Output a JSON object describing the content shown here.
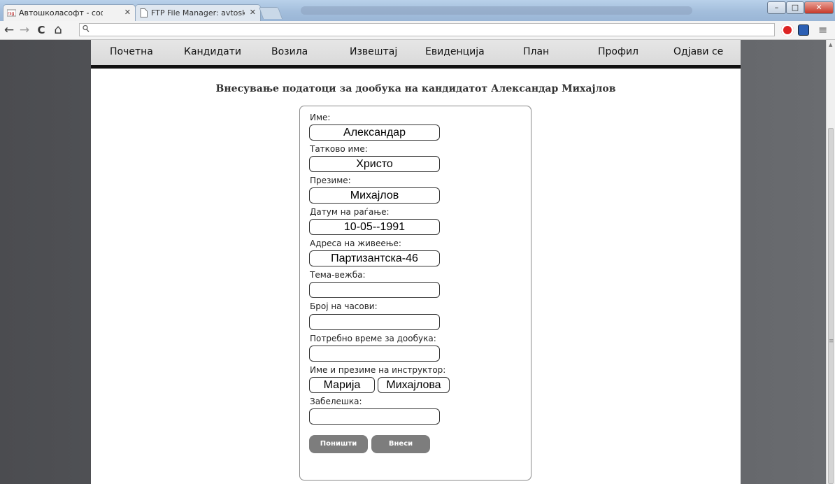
{
  "browser": {
    "tabs": [
      {
        "label": "Автошколасофт - софтв",
        "favicon": "site-favicon",
        "active": true
      },
      {
        "label": "FTP File Manager: avtosko",
        "favicon": "page-icon",
        "active": false
      }
    ],
    "window_controls": {
      "minimize": "–",
      "maximize": "□",
      "close": "✕"
    },
    "nav": {
      "back": "←",
      "forward": "→",
      "reload": "C",
      "home": "⌂"
    },
    "address": {
      "value": "",
      "icon": "search-icon"
    },
    "extensions": [
      "stop-extension-icon",
      "extension-icon"
    ],
    "menu_icon": "≡"
  },
  "nav": {
    "items": [
      "Почетна",
      "Кандидати",
      "Возила",
      "Извештај",
      "Евиденција",
      "План",
      "Профил",
      "Одјави се"
    ]
  },
  "page": {
    "heading": "Внесување податоци за дообука на кандидатот Александар Михајлов"
  },
  "form": {
    "fields": [
      {
        "label": "Име:",
        "value": "Александар"
      },
      {
        "label": "Татково име:",
        "value": "Христо"
      },
      {
        "label": "Презиме:",
        "value": "Михајлов"
      },
      {
        "label": "Датум на раѓање:",
        "value": "10-05--1991"
      },
      {
        "label": "Адреса на живеење:",
        "value": "Партизантска-46"
      },
      {
        "label": "Тема-вежба:",
        "value": ""
      },
      {
        "label": "Број на часови:",
        "value": ""
      },
      {
        "label": "Потребно време за дообука:",
        "value": ""
      },
      {
        "label": "Име и презиме на инструктор:",
        "first_name": "Марија",
        "last_name": "Михајлова"
      },
      {
        "label": "Забелешка:",
        "value": ""
      }
    ],
    "buttons": {
      "cancel": "Поништи",
      "submit": "Внеси"
    }
  },
  "colors": {
    "background": "#5e6064",
    "page": "#ffffff",
    "nav_bar": "#dedede",
    "nav_border": "#111111",
    "button": "#7d7d7d"
  }
}
